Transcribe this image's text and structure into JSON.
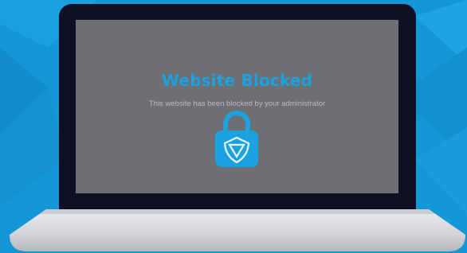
{
  "blocked_page": {
    "title": "Website Blocked",
    "message": "This website has been blocked by your administrator"
  },
  "icons": {
    "lock": "padlock-icon",
    "shield": "shield-logo-icon"
  },
  "colors": {
    "background": "#1497d6",
    "screen": "#6e6f73",
    "title": "#1aa3e0",
    "lock": "#1aa3e0",
    "bezel": "#0e1024"
  }
}
